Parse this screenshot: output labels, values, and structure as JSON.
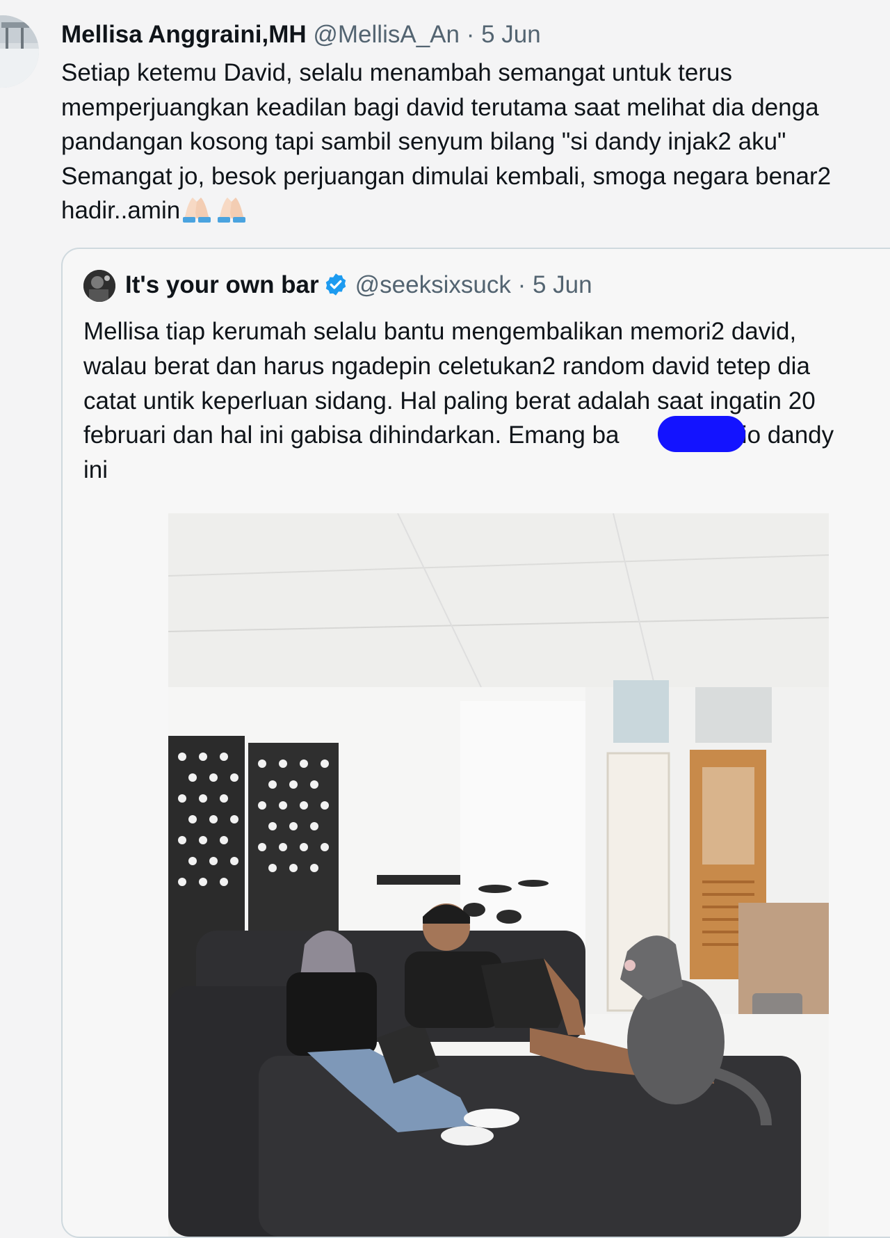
{
  "tweet": {
    "author_name": "Mellisa Anggraini,MH",
    "handle": "@MellisA_An",
    "separator": "·",
    "date": "5 Jun",
    "text": "Setiap ketemu David, selalu menambah semangat untuk terus\nmemperjuangkan keadilan bagi david terutama saat melihat dia denga\npandangan kosong tapi sambil senyum bilang \"si dandy injak2 aku\"\nSemangat jo, besok perjuangan dimulai kembali, smoga negara benar2\nhadir..amin",
    "emoji": "🙏🏻🙏🏻"
  },
  "quoted": {
    "author_name": "It's your own bar",
    "verified_icon": "verified-badge-icon",
    "handle": "@seeksixsuck",
    "separator": "·",
    "date": "5 Jun",
    "text_part1": "Mellisa tiap kerumah selalu bantu mengembalikan memori2 david,\nwalau berat dan harus ngadepin celetukan2 random david tetep dia\ncatat untik keperluan sidang. Hal paling berat adalah saat ingatin 20\nfebruari dan hal ini gabisa dihindarkan. Emang ba",
    "text_part2": "mario dandy\nini",
    "redaction_color": "#1313ff"
  },
  "colors": {
    "background": "#f4f4f5",
    "text": "#0f1419",
    "secondary": "#536471",
    "verified": "#1d9bf0",
    "card_border": "#cfd9de"
  }
}
